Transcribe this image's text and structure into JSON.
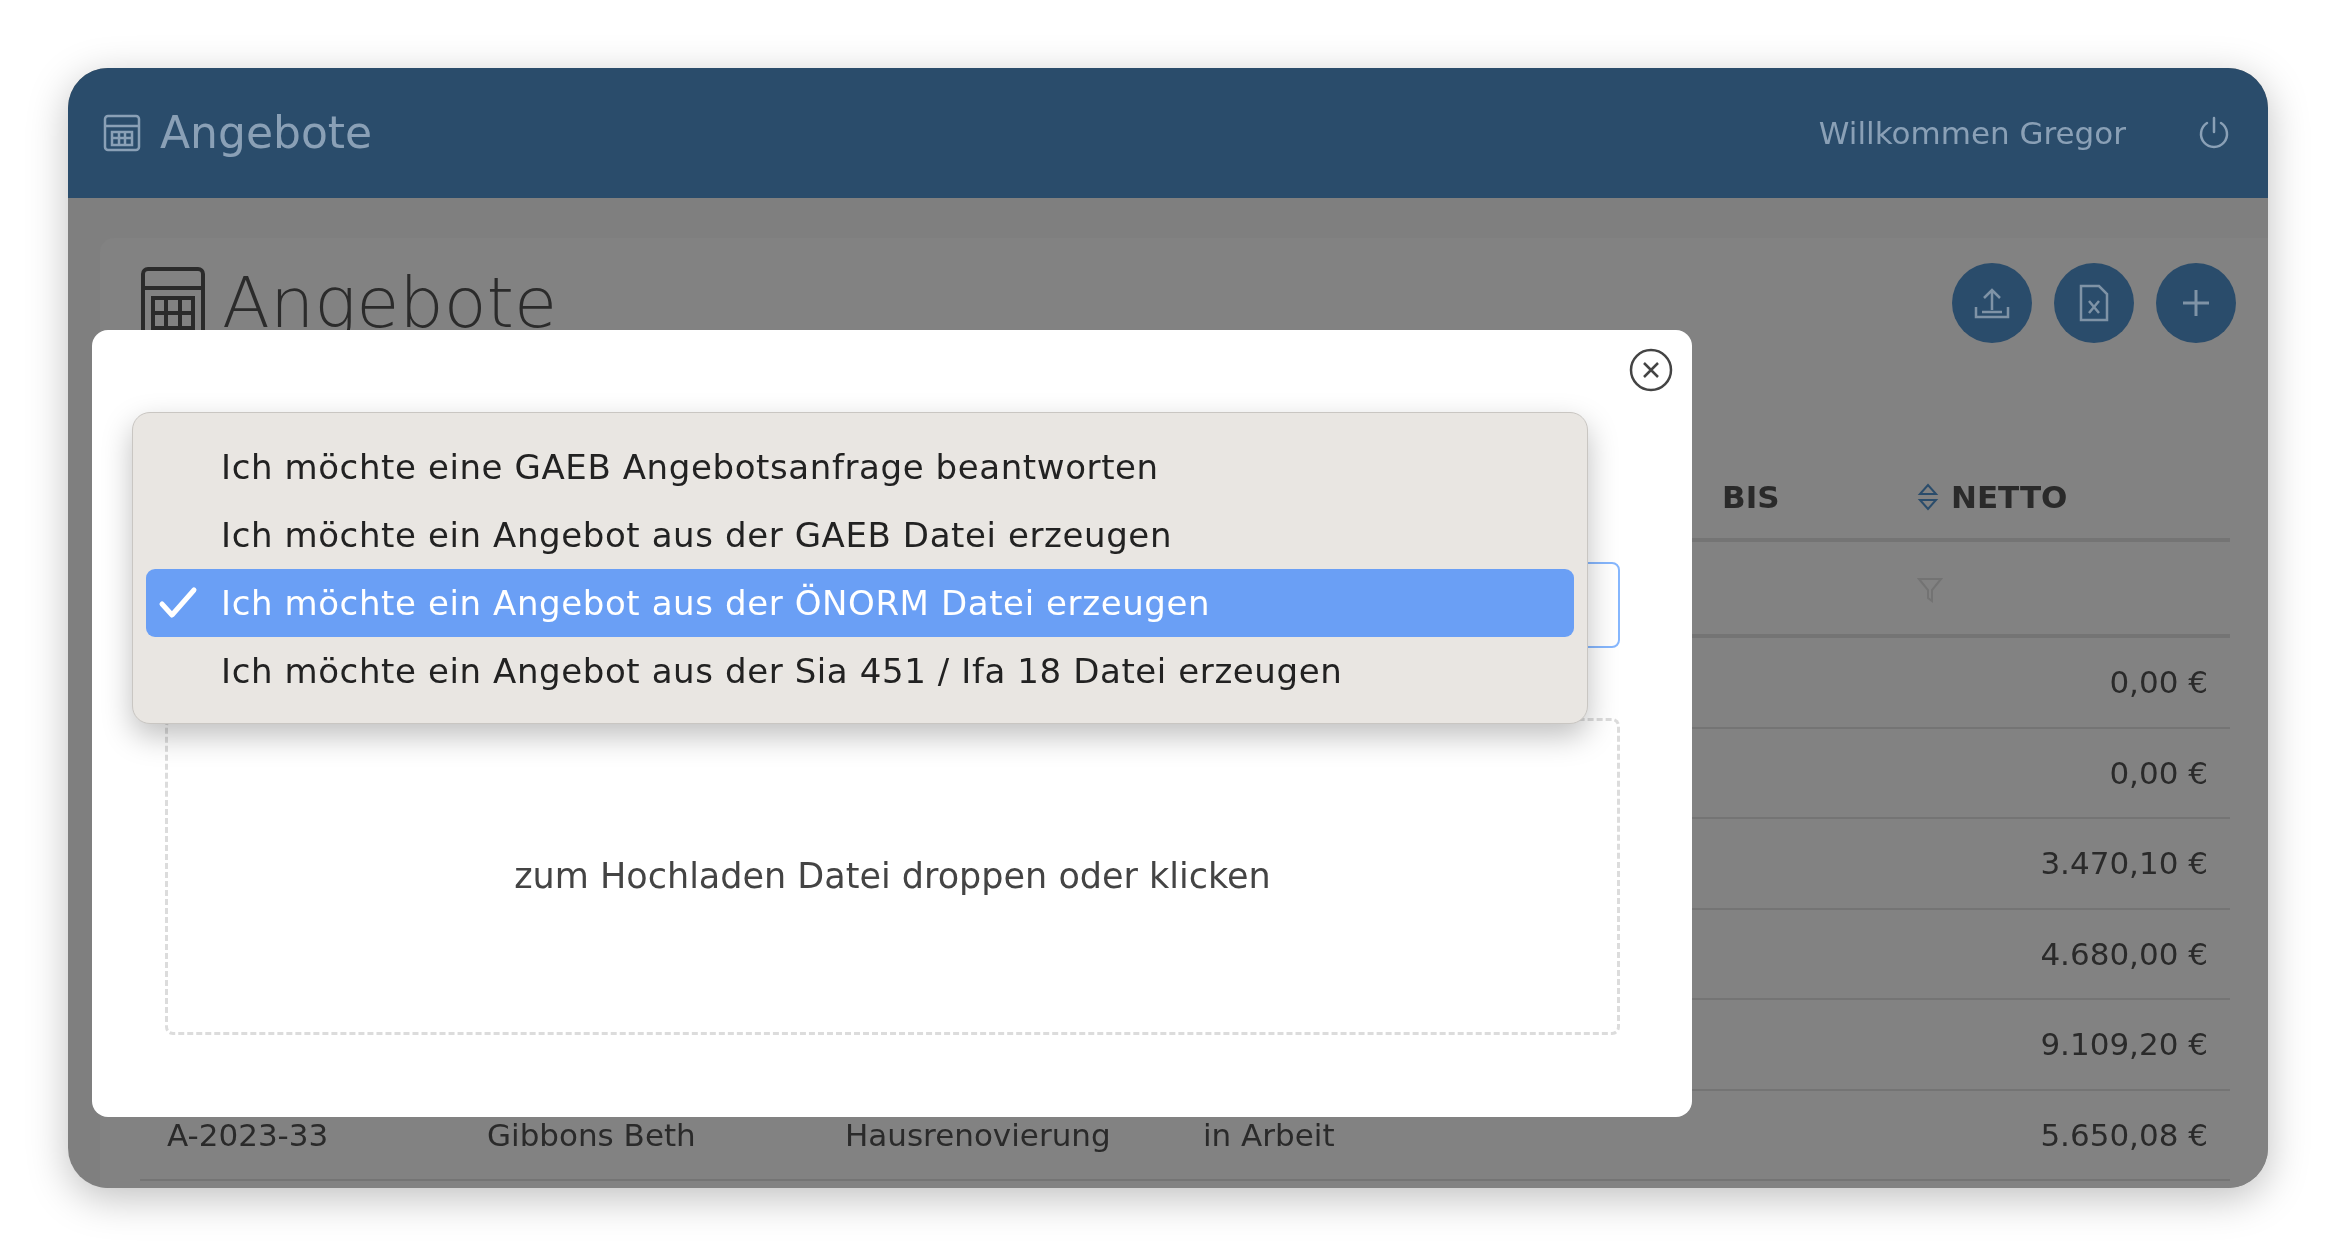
{
  "header": {
    "title": "Angebote",
    "greeting": "Willkommen Gregor"
  },
  "page": {
    "title": "Angebote"
  },
  "table": {
    "columns": [
      "BIS",
      "NETTO"
    ],
    "rows": [
      {
        "netto": "0,00 €"
      },
      {
        "netto": "0,00 €"
      },
      {
        "netto": "3.470,10 €"
      },
      {
        "netto": "4.680,00 €"
      },
      {
        "netto": "9.109,20 €"
      },
      {
        "column_1": "A-2023-33",
        "column_2": "Gibbons Beth",
        "column_3": "Hausrenovierung",
        "column_4": "in Arbeit",
        "netto": "5.650,08 €"
      }
    ]
  },
  "modal": {
    "options": [
      {
        "label": "Ich möchte eine GAEB Angebotsanfrage beantworten",
        "selected": false
      },
      {
        "label": "Ich möchte ein Angebot aus der GAEB Datei erzeugen",
        "selected": false
      },
      {
        "label": "Ich möchte ein Angebot aus der ÖNORM Datei erzeugen",
        "selected": true
      },
      {
        "label": "Ich möchte ein Angebot aus der Sia 451 / Ifa 18 Datei erzeugen",
        "selected": false
      }
    ],
    "dropzone": {
      "text": "zum Hochladen Datei droppen oder klicken"
    }
  }
}
